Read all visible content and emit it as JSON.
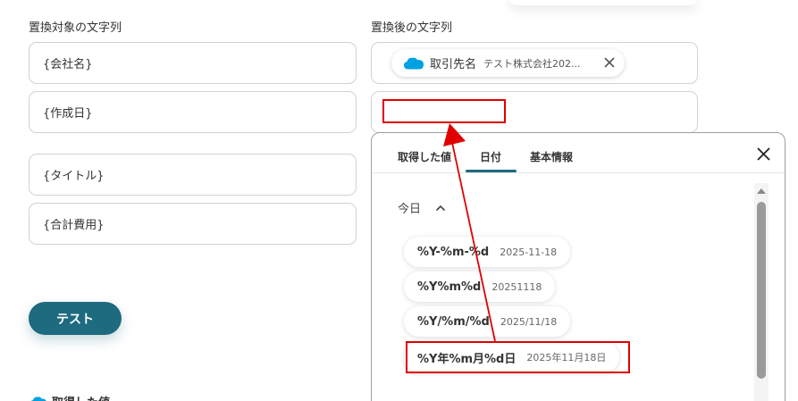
{
  "left": {
    "label": "置換対象の文字列",
    "fields": [
      "{会社名}",
      "{作成日}",
      "{タイトル}",
      "{合計費用}"
    ],
    "test_button": "テスト",
    "bottom_label": "取得した値"
  },
  "right": {
    "label": "置換後の文字列",
    "chip": {
      "icon": "salesforce-cloud-icon",
      "label": "取引先名",
      "value": "テスト株式会社202..."
    }
  },
  "panel": {
    "tabs": [
      "取得した値",
      "日付",
      "基本情報"
    ],
    "active_tab": "日付",
    "section": "今日",
    "options": [
      {
        "format": "%Y-%m-%d",
        "example": "2025-11-18"
      },
      {
        "format": "%Y%m%d",
        "example": "20251118"
      },
      {
        "format": "%Y/%m/%d",
        "example": "2025/11/18"
      },
      {
        "format": "%Y年%m月%d日",
        "example": "2025年11月18日"
      }
    ]
  },
  "colors": {
    "accent": "#1e6a7e",
    "annotation_red": "#e00000",
    "salesforce_blue": "#00a1e0"
  }
}
